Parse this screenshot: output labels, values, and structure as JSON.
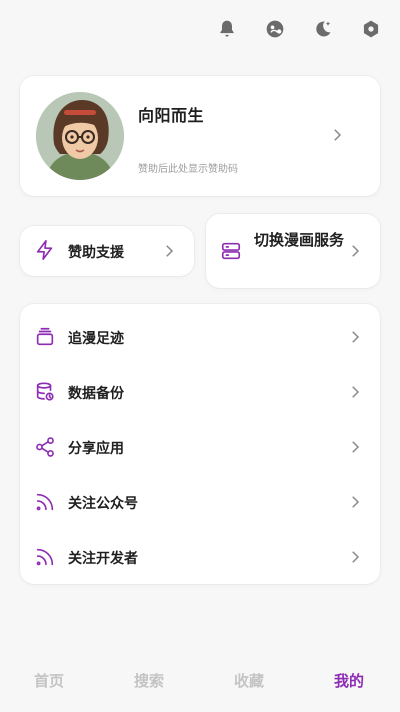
{
  "topbar": {
    "icons": [
      "bell-icon",
      "theme-avatar-icon",
      "moon-icon",
      "settings-icon"
    ]
  },
  "profile": {
    "name": "向阳而生",
    "subtitle": "赞助后此处显示赞助码"
  },
  "quick": {
    "sponsor_label": "赞助支援",
    "switch_service_label": "切换漫画服务"
  },
  "menu": {
    "items": [
      {
        "label": "追漫足迹",
        "icon": "bookshelf-icon"
      },
      {
        "label": "数据备份",
        "icon": "database-icon"
      },
      {
        "label": "分享应用",
        "icon": "share-icon"
      },
      {
        "label": "关注公众号",
        "icon": "rss-icon"
      },
      {
        "label": "关注开发者",
        "icon": "rss-icon"
      }
    ]
  },
  "tabs": [
    {
      "label": "首页",
      "active": false
    },
    {
      "label": "搜索",
      "active": false
    },
    {
      "label": "收藏",
      "active": false
    },
    {
      "label": "我的",
      "active": true
    }
  ],
  "colors": {
    "accent": "#8e2db4",
    "inactive_tab": "#c4c4c4",
    "background": "#f7f7f7"
  }
}
